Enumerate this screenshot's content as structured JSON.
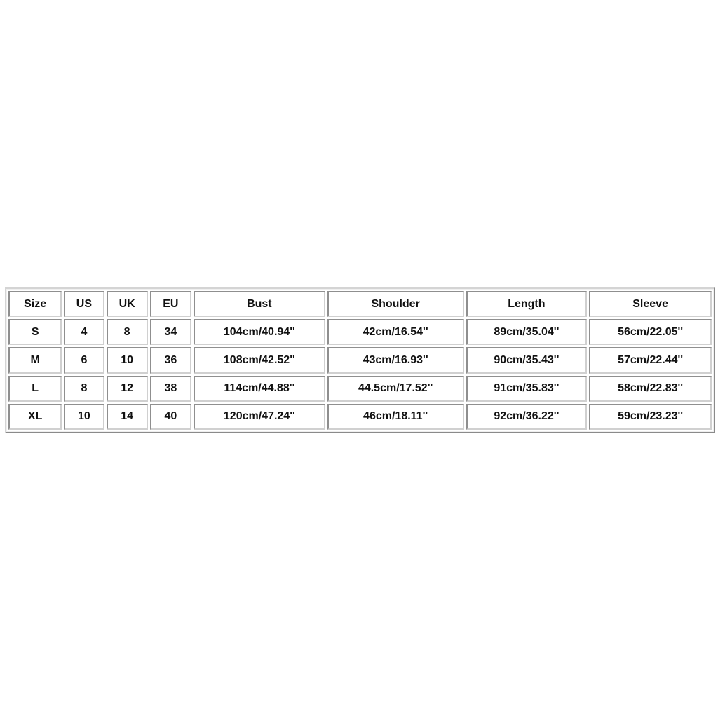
{
  "size_chart": {
    "headers": [
      "Size",
      "US",
      "UK",
      "EU",
      "Bust",
      "Shoulder",
      "Length",
      "Sleeve"
    ],
    "rows": [
      [
        "S",
        "4",
        "8",
        "34",
        "104cm/40.94''",
        "42cm/16.54''",
        "89cm/35.04''",
        "56cm/22.05''"
      ],
      [
        "M",
        "6",
        "10",
        "36",
        "108cm/42.52''",
        "43cm/16.93''",
        "90cm/35.43''",
        "57cm/22.44''"
      ],
      [
        "L",
        "8",
        "12",
        "38",
        "114cm/44.88''",
        "44.5cm/17.52''",
        "91cm/35.83''",
        "58cm/22.83''"
      ],
      [
        "XL",
        "10",
        "14",
        "40",
        "120cm/47.24''",
        "46cm/18.11''",
        "92cm/36.22''",
        "59cm/23.23''"
      ]
    ]
  }
}
